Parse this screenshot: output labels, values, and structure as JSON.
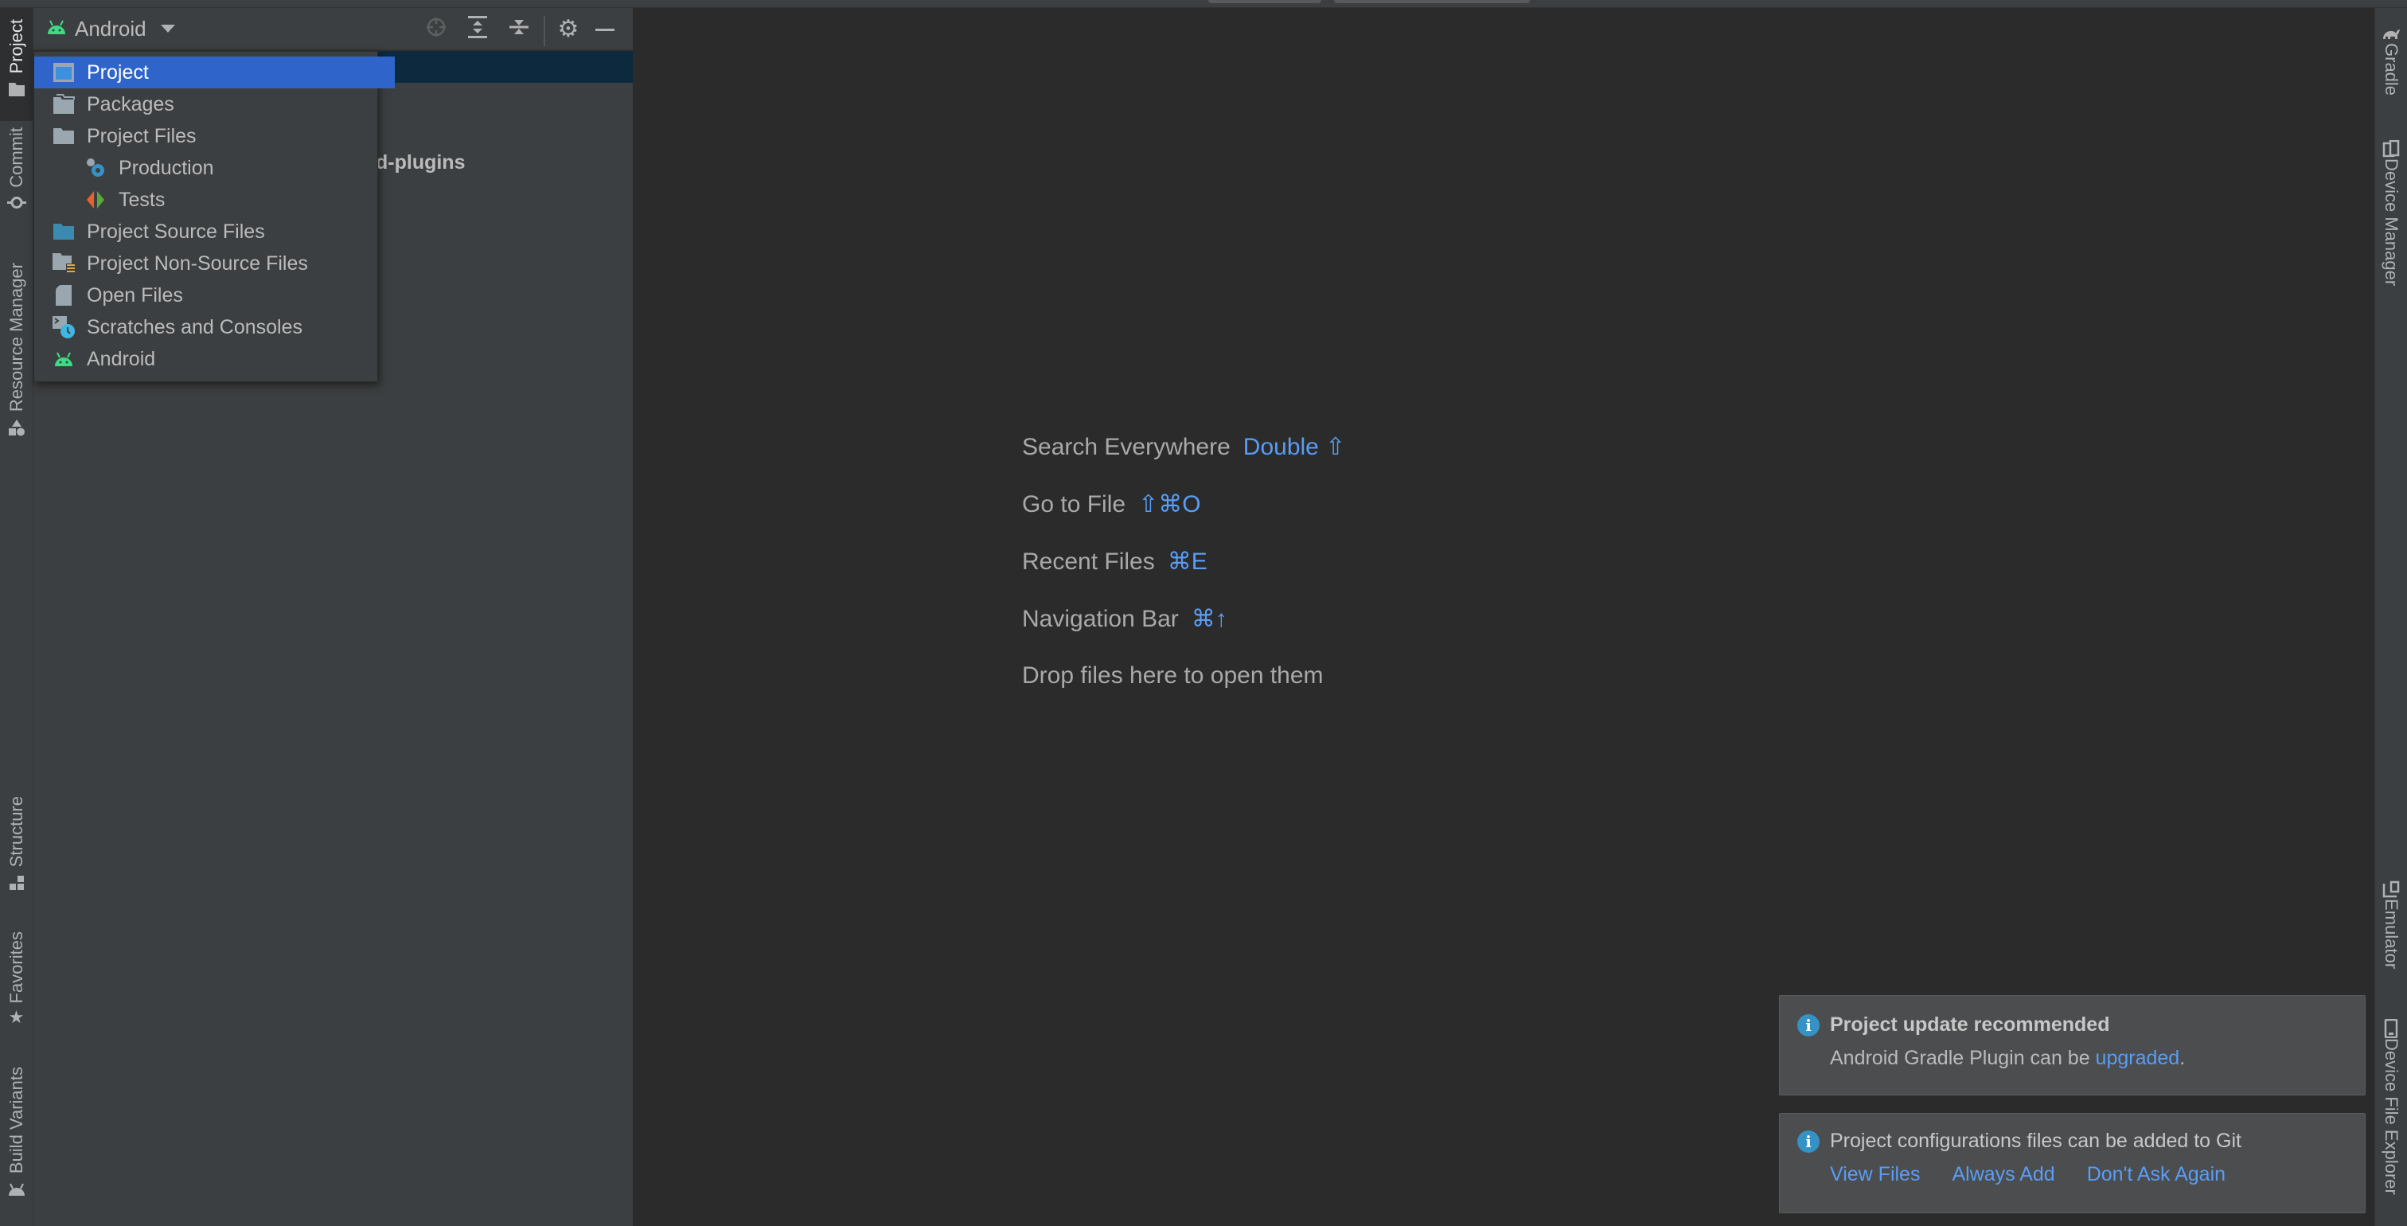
{
  "project_panel": {
    "view_selector_label": "Android",
    "tree_partial_text": "d-plugins",
    "toolbar": {
      "locate_icon": "crosshair-icon",
      "expand_icon": "expand-all-icon",
      "collapse_icon": "collapse-all-icon",
      "settings_icon": "gear-icon",
      "hide_icon": "minimize-icon"
    }
  },
  "view_dropdown": {
    "selected": "Project",
    "items": [
      {
        "label": "Project",
        "icon": "project-window-icon",
        "indent": 0
      },
      {
        "label": "Packages",
        "icon": "packages-icon",
        "indent": 0
      },
      {
        "label": "Project Files",
        "icon": "folder-icon",
        "indent": 0
      },
      {
        "label": "Production",
        "icon": "production-gears-icon",
        "indent": 1
      },
      {
        "label": "Tests",
        "icon": "tests-icon",
        "indent": 1
      },
      {
        "label": "Project Source Files",
        "icon": "source-folder-icon",
        "indent": 0
      },
      {
        "label": "Project Non-Source Files",
        "icon": "non-source-folder-icon",
        "indent": 0
      },
      {
        "label": "Open Files",
        "icon": "file-icon",
        "indent": 0
      },
      {
        "label": "Scratches and Consoles",
        "icon": "scratches-clock-icon",
        "indent": 0
      },
      {
        "label": "Android",
        "icon": "android-icon",
        "indent": 0
      }
    ]
  },
  "left_tool_tabs": [
    {
      "label": "Project",
      "active": true
    },
    {
      "label": "Commit",
      "active": false
    },
    {
      "label": "Resource Manager",
      "active": false
    },
    {
      "label": "Structure",
      "active": false
    },
    {
      "label": "Favorites",
      "active": false
    },
    {
      "label": "Build Variants",
      "active": false
    }
  ],
  "right_tool_tabs": [
    {
      "label": "Gradle"
    },
    {
      "label": "Device Manager"
    },
    {
      "label": "Emulator"
    },
    {
      "label": "Device File Explorer"
    }
  ],
  "editor_hints": [
    {
      "label": "Search Everywhere",
      "shortcut": "Double ⇧"
    },
    {
      "label": "Go to File",
      "shortcut": "⇧⌘O"
    },
    {
      "label": "Recent Files",
      "shortcut": "⌘E"
    },
    {
      "label": "Navigation Bar",
      "shortcut": "⌘↑"
    },
    {
      "label": "Drop files here to open them",
      "shortcut": ""
    }
  ],
  "notifications": [
    {
      "title": "Project update recommended",
      "body_prefix": "Android Gradle Plugin can be ",
      "body_link": "upgraded",
      "body_suffix": "."
    },
    {
      "title": "Project configurations files can be added to Git",
      "actions": [
        "View Files",
        "Always Add",
        "Don't Ask Again"
      ]
    }
  ],
  "colors": {
    "accent": "#2f65ca",
    "link": "#589df6",
    "android_green": "#3ddc84",
    "info": "#3592c4"
  }
}
